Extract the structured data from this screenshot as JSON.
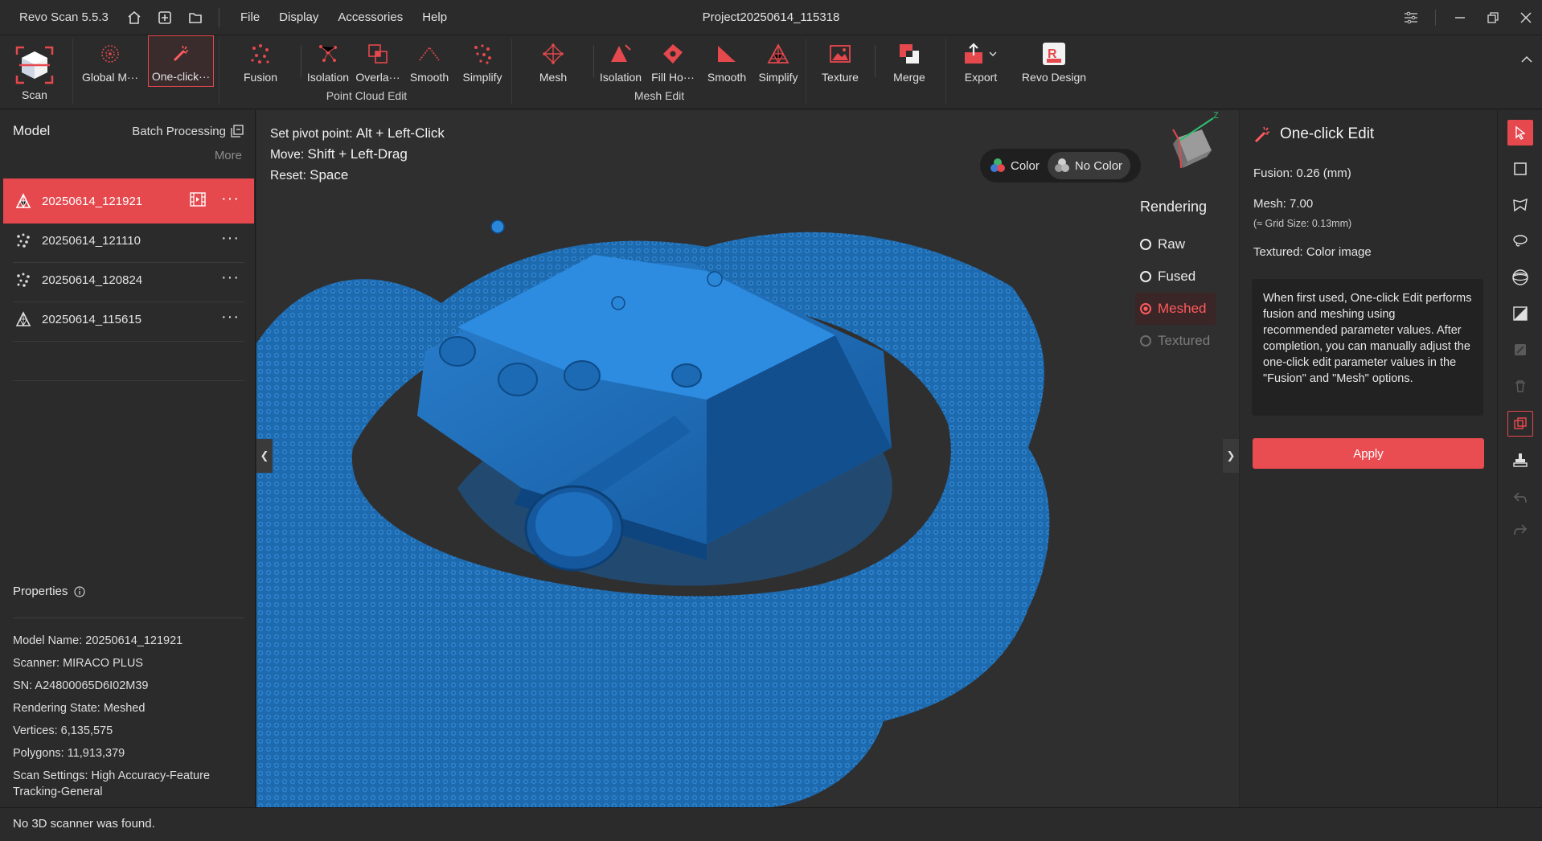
{
  "app": {
    "title": "Revo Scan 5.5.3",
    "project_title": "Project20250614_115318",
    "menu": [
      "File",
      "Display",
      "Accessories",
      "Help"
    ]
  },
  "ribbon": {
    "scan": "Scan",
    "global_mapping": "Global M···",
    "one_click": "One-click···",
    "pc_fusion": "Fusion",
    "pc_isolation": "Isolation",
    "pc_overlap": "Overla···",
    "pc_smooth": "Smooth",
    "pc_simplify": "Simplify",
    "point_cloud_group": "Point Cloud Edit",
    "mesh": "Mesh",
    "m_isolation": "Isolation",
    "m_fill": "Fill Ho···",
    "m_smooth": "Smooth",
    "m_simplify": "Simplify",
    "mesh_group": "Mesh Edit",
    "texture": "Texture",
    "merge": "Merge",
    "export": "Export",
    "revo_design": "Revo Design"
  },
  "left": {
    "title": "Model",
    "batch": "Batch Processing",
    "more": "More",
    "models": [
      {
        "name": "20250614_121921"
      },
      {
        "name": "20250614_121110"
      },
      {
        "name": "20250614_120824"
      },
      {
        "name": "20250614_115615"
      }
    ],
    "properties_title": "Properties",
    "props": [
      "Model Name:  20250614_121921",
      "Scanner:  MIRACO PLUS",
      "SN:  A24800065D6I02M39",
      "Rendering State:  Meshed",
      "Vertices:  6,135,575",
      "Polygons:  11,913,379",
      "Scan Settings:  High Accuracy-Feature Tracking-General"
    ]
  },
  "viewport": {
    "hint1_label": "Set pivot point: ",
    "hint1_keys": "Alt + Left-Click",
    "hint2_label": "Move: ",
    "hint2_keys": "Shift + Left-Drag",
    "hint3_label": "Reset: ",
    "hint3_keys": "Space",
    "color_on": "Color",
    "color_off": "No Color",
    "rendering_title": "Rendering",
    "rendering_options": [
      "Raw",
      "Fused",
      "Meshed",
      "Textured"
    ],
    "rendering_selected": "Meshed",
    "model_color": "#1f6fb8"
  },
  "right": {
    "title": "One-click Edit",
    "fusion": "Fusion:  0.26 (mm)",
    "mesh": "Mesh:  7.00",
    "grid": "(≈ Grid Size: 0.13mm)",
    "textured": "Textured: Color image",
    "description": "When first used, One-click Edit performs fusion and meshing using recommended parameter values. After completion, you can manually adjust the one-click edit parameter values in the \"Fusion\" and \"Mesh\" options.",
    "apply": "Apply"
  },
  "status": "No 3D scanner was found.",
  "colors": {
    "accent": "#e5484d",
    "bg": "#2b2b2b",
    "viewport": "#2f2f2f"
  }
}
